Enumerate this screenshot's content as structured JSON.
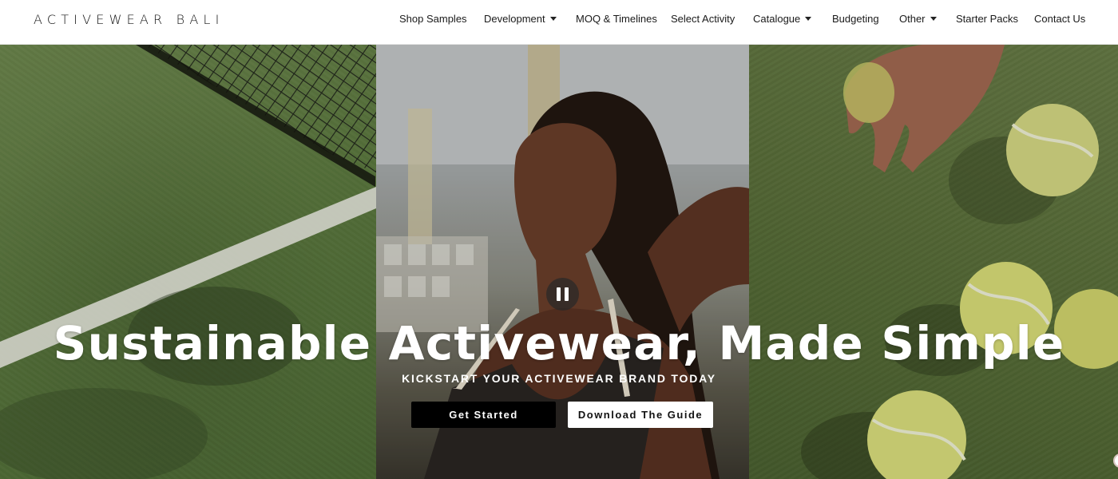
{
  "header": {
    "logo": "ACTIVEWEAR BALI",
    "nav": [
      {
        "label": "Shop Samples",
        "dropdown": false
      },
      {
        "label": "Development",
        "dropdown": true
      },
      {
        "label": "MOQ & Timelines",
        "dropdown": false
      },
      {
        "label": "Select Activity",
        "dropdown": false
      },
      {
        "label": "Catalogue",
        "dropdown": true
      },
      {
        "label": "Budgeting",
        "dropdown": false
      },
      {
        "label": "Other",
        "dropdown": true
      },
      {
        "label": "Starter Packs",
        "dropdown": false
      },
      {
        "label": "Contact Us",
        "dropdown": false
      }
    ]
  },
  "hero": {
    "title": "Sustainable Activewear, Made Simple",
    "subtitle": "KICKSTART YOUR ACTIVEWEAR BRAND TODAY",
    "primary_button": "Get Started",
    "secondary_button": "Download The Guide",
    "media_control_icon": "pause-icon"
  },
  "colors": {
    "primary_button_bg": "#000000",
    "secondary_button_bg": "#ffffff",
    "hero_text": "#ffffff"
  }
}
